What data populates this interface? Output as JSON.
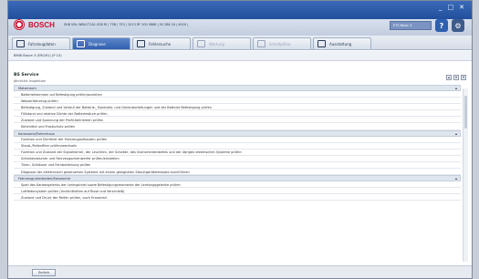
{
  "titlebar": {
    "brand": "BOSCH",
    "vehicle_info": "SHB VIN: WBA1T1A1-SSB RI | TSB | 7E3 | 2013 RF 200 0886 | 00 288 18 | 4000 |",
    "version": "ETS Basic 3.",
    "help_label": "?",
    "controls": [
      "_",
      "□",
      "✕"
    ]
  },
  "tabs": [
    {
      "label": "Fahrzeugdaten",
      "state": "normal"
    },
    {
      "label": "Diagnose",
      "state": "active"
    },
    {
      "label": "Fehlersuche",
      "state": "normal"
    },
    {
      "label": "Wartung",
      "state": "disabled"
    },
    {
      "label": "Schaltpläne",
      "state": "disabled"
    },
    {
      "label": "Ausstattung",
      "state": "normal"
    }
  ],
  "breadcrumb": "BMW Baure 3 (E90/91) (P 10)",
  "main": {
    "title": "BS Service",
    "subtitle": "Jährliche Inspektion",
    "groups": [
      {
        "header": "Motorraum",
        "rows": [
          "Batterieklemmen auf Befestigung prüfen/anziehen",
          "Wasserfahrzeug prüfen",
          "Befestigung, Zustand und Verlauf der Batterie-, Bordnetz- und Generatorleitungen und der Batterie Befestigung prüfen",
          "Füllstand und relative Dichte der Batteriesäure prüfen",
          "Zustand und Spannung der Profil-Keilriemen prüfen",
          "Kühlmittel und Frostschutz prüfen"
        ]
      },
      {
        "header": "Karosserie/Fahrerhaus",
        "rows": [
          "Funktion und Dichtheit der Fahrzeugaufbauten prüfen",
          "Staub-/Pollenfilter prüfen/wechseln",
          "Funktion und Zustand der Signalhörner, der Leuchten, der Schalter, des Instrumentenbretts und der übrigen elektrischen Systeme prüfen",
          "Scheibenwischer und Fahrzeugscheinwerfer prüfen/einstellen",
          "Türen, Schlösser und Fernbedienung prüfen",
          "Diagnose der elektronisch gesteuerten Systeme mit einem geeigneten Steuergerätetestsatz durchführen"
        ]
      },
      {
        "header": "Fahrzeugunterboden/Karosserie",
        "rows": [
          "Spiel des Kardangelenks der Lenkspindel sowie Befestigungsmomente der Lenkungsgelenke prüfen",
          "Luftfedersystem prüfen (Undichtheiten auf Risse und Verschleiß)",
          "Zustand und Druck der Reifen prüfen, auch Ersatzrad"
        ]
      }
    ]
  },
  "footer": {
    "button_label": "Zurück"
  },
  "colors": {
    "accent": "#2f5fb0",
    "brand": "#c8102e"
  }
}
